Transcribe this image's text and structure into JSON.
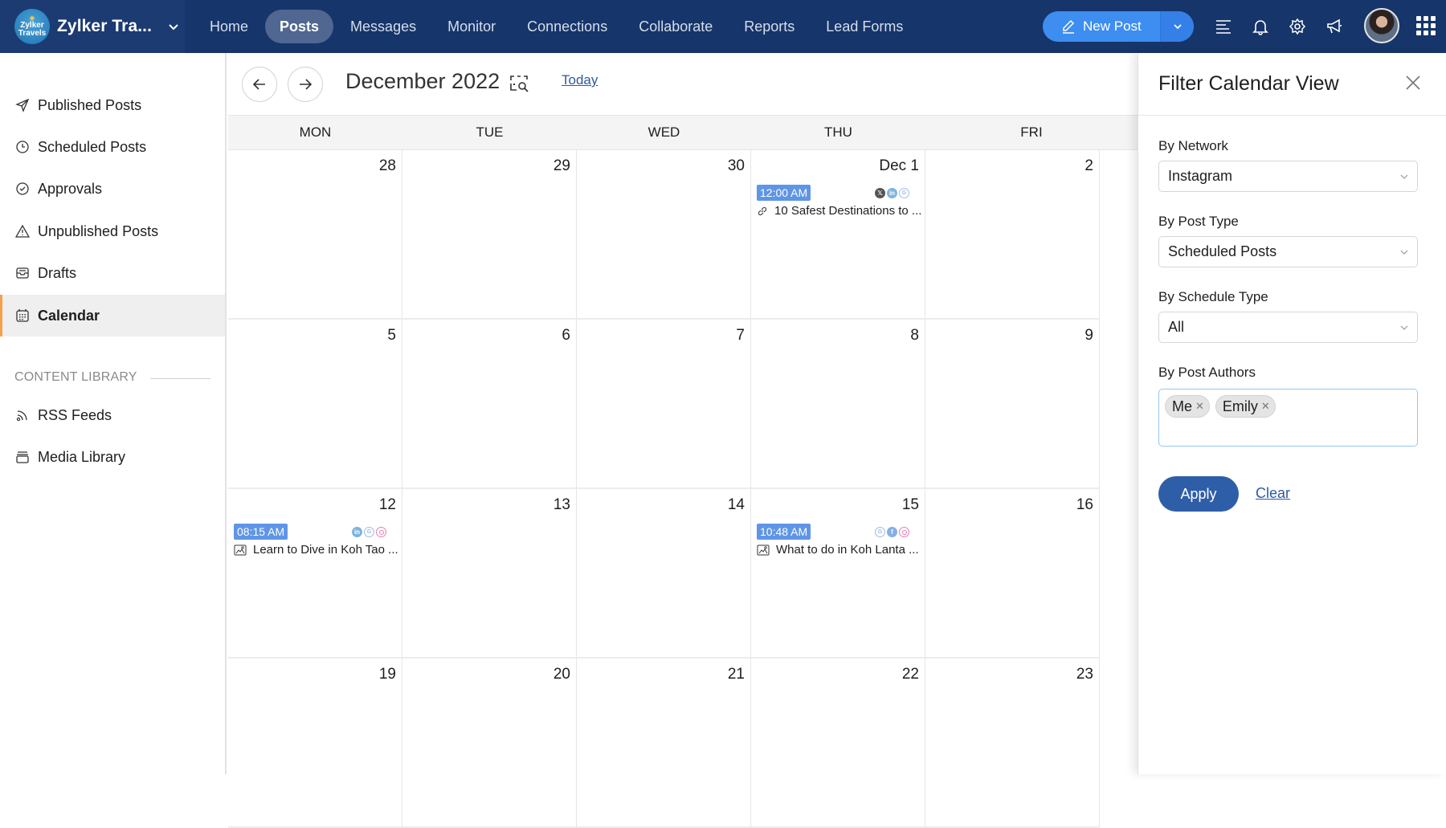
{
  "app": {
    "brand_name": "Zylker Tra...",
    "brand_logo_text": [
      "Zylker",
      "Travels"
    ]
  },
  "nav": {
    "items": [
      {
        "label": "Home",
        "active": false
      },
      {
        "label": "Posts",
        "active": true
      },
      {
        "label": "Messages",
        "active": false
      },
      {
        "label": "Monitor",
        "active": false
      },
      {
        "label": "Connections",
        "active": false
      },
      {
        "label": "Collaborate",
        "active": false
      },
      {
        "label": "Reports",
        "active": false
      },
      {
        "label": "Lead Forms",
        "active": false
      }
    ],
    "new_post_label": "New Post",
    "icons": [
      "list-icon",
      "bell-icon",
      "gear-icon",
      "megaphone-icon"
    ]
  },
  "sidebar": {
    "items": [
      {
        "label": "Published Posts",
        "icon": "paper-plane-icon",
        "active": false
      },
      {
        "label": "Scheduled Posts",
        "icon": "clock-icon",
        "active": false
      },
      {
        "label": "Approvals",
        "icon": "check-circle-icon",
        "active": false
      },
      {
        "label": "Unpublished Posts",
        "icon": "warning-icon",
        "active": false
      },
      {
        "label": "Drafts",
        "icon": "inbox-tray-icon",
        "active": false
      },
      {
        "label": "Calendar",
        "icon": "calendar-icon",
        "active": true
      }
    ],
    "section_label": "CONTENT LIBRARY",
    "library_items": [
      {
        "label": "RSS Feeds",
        "icon": "rss-icon"
      },
      {
        "label": "Media Library",
        "icon": "media-stack-icon"
      }
    ]
  },
  "calendar": {
    "month_title": "December 2022",
    "today_label": "Today",
    "weekdays": [
      "MON",
      "TUE",
      "WED",
      "THU",
      "FRI"
    ],
    "weeks": [
      [
        "28",
        "29",
        "30",
        "Dec 1",
        "2"
      ],
      [
        "5",
        "6",
        "7",
        "8",
        "9"
      ],
      [
        "12",
        "13",
        "14",
        "15",
        "16"
      ],
      [
        "19",
        "20",
        "21",
        "22",
        "23"
      ]
    ],
    "posts": [
      {
        "week": 0,
        "day": 3,
        "time": "12:00 AM",
        "title": "10 Safest Destinations to ...",
        "type": "link",
        "networks": [
          "x",
          "linkedin",
          "google"
        ]
      },
      {
        "week": 2,
        "day": 0,
        "time": "08:15 AM",
        "title": "Learn to Dive in Koh Tao ...",
        "type": "image",
        "networks": [
          "linkedin",
          "google",
          "instagram"
        ]
      },
      {
        "week": 2,
        "day": 3,
        "time": "10:48 AM",
        "title": "What to do in Koh Lanta ...",
        "type": "image",
        "networks": [
          "google",
          "facebook",
          "instagram"
        ]
      }
    ]
  },
  "filter_panel": {
    "title": "Filter Calendar View",
    "network": {
      "label": "By Network",
      "value": "Instagram"
    },
    "post_type": {
      "label": "By Post Type",
      "value": "Scheduled Posts"
    },
    "schedule_type": {
      "label": "By Schedule Type",
      "value": "All"
    },
    "authors": {
      "label": "By Post Authors",
      "chips": [
        "Me",
        "Emily"
      ]
    },
    "apply_label": "Apply",
    "clear_label": "Clear"
  },
  "colors": {
    "topbar": "#16356a",
    "accent_button": "#3d8ef0",
    "apply_button": "#2f5ea8",
    "active_indicator": "#f4a14a",
    "time_badge": "#5f95e6"
  }
}
